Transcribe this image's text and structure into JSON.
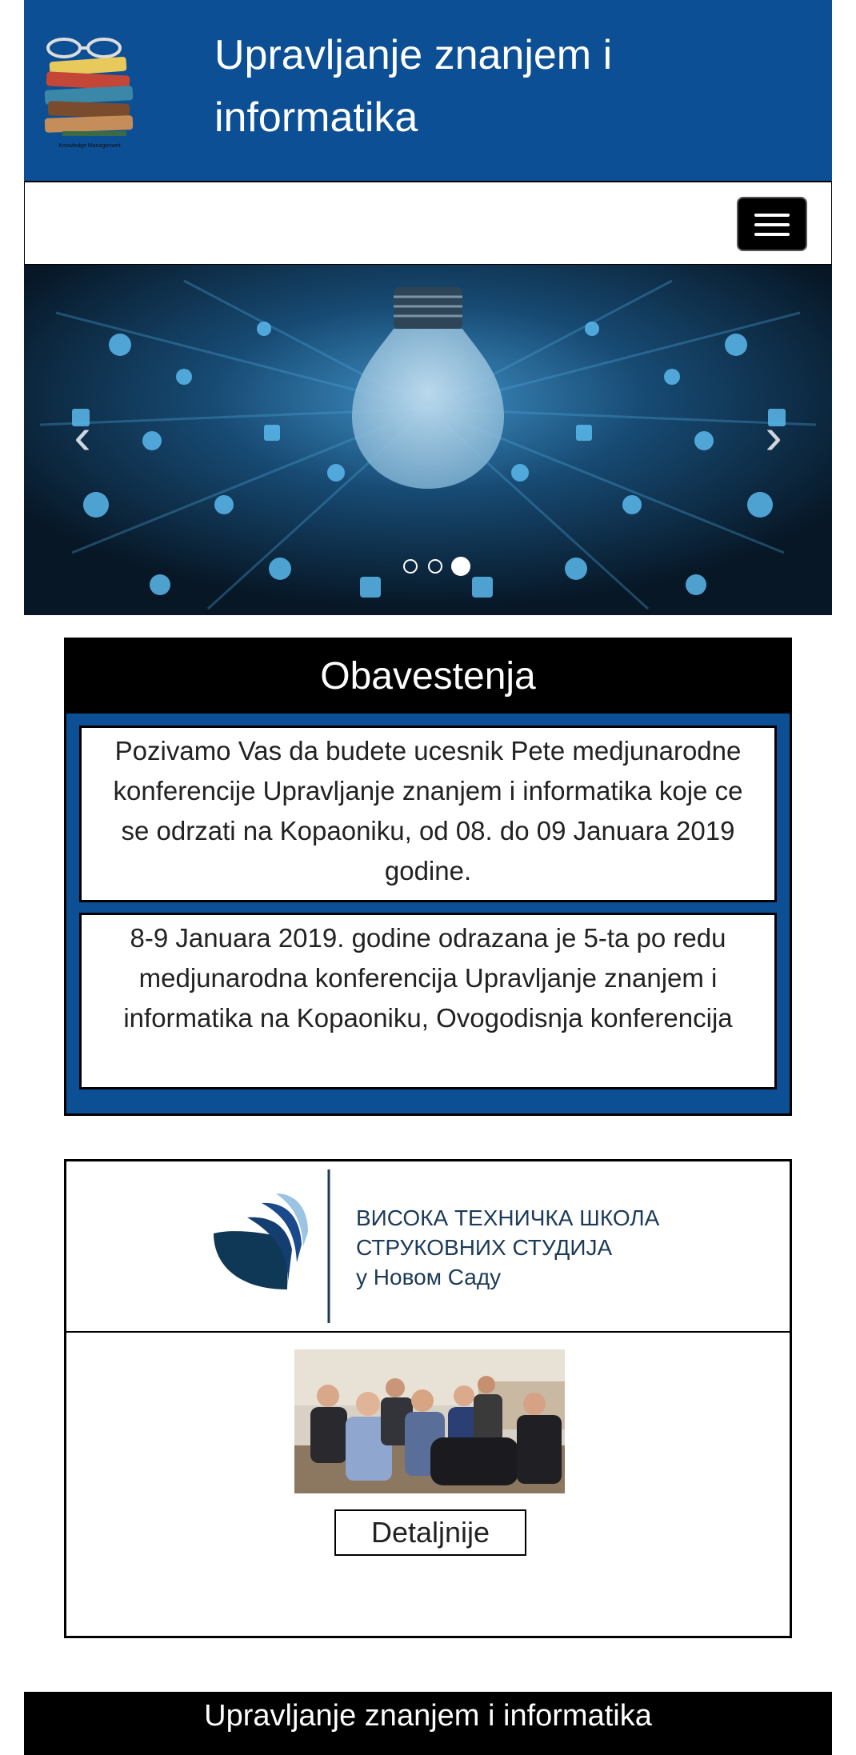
{
  "header": {
    "title": "Upravljanje znanjem i informatika",
    "logo_icon": "books-with-glasses-icon",
    "logo_caption": "Knowledge Management"
  },
  "navbar": {
    "toggle_icon": "hamburger-menu-icon"
  },
  "carousel": {
    "prev_icon": "chevron-left-icon",
    "next_icon": "chevron-right-icon",
    "prev_glyph": "‹",
    "next_glyph": "›",
    "slide_count": 3,
    "active_slide": 3
  },
  "notices": {
    "title": "Obavestenja",
    "items": [
      "Pozivamo Vas da budete ucesnik Pete medjunarodne konferencije Upravljanje znanjem i informatika koje ce se odrzati na Kopaoniku, od 08. do 09 Januara 2019 godine.",
      "8-9 Januara 2019. godine odrazana je 5-ta po redu medjunarodna konferencija Upravljanje znanjem i informatika na Kopaoniku, Ovogodisnja konferencija"
    ]
  },
  "card": {
    "school_lines": [
      "ВИСОКА ТЕХНИЧКА ШКОЛА",
      "СТРУКОВНИХ СТУДИЈА",
      "у Новом Саду"
    ],
    "details_button": "Detaljnije"
  },
  "footer": {
    "title": "Upravljanje znanjem i informatika"
  },
  "colors": {
    "brand_blue": "#0d4f94",
    "black": "#000000",
    "white": "#ffffff"
  }
}
